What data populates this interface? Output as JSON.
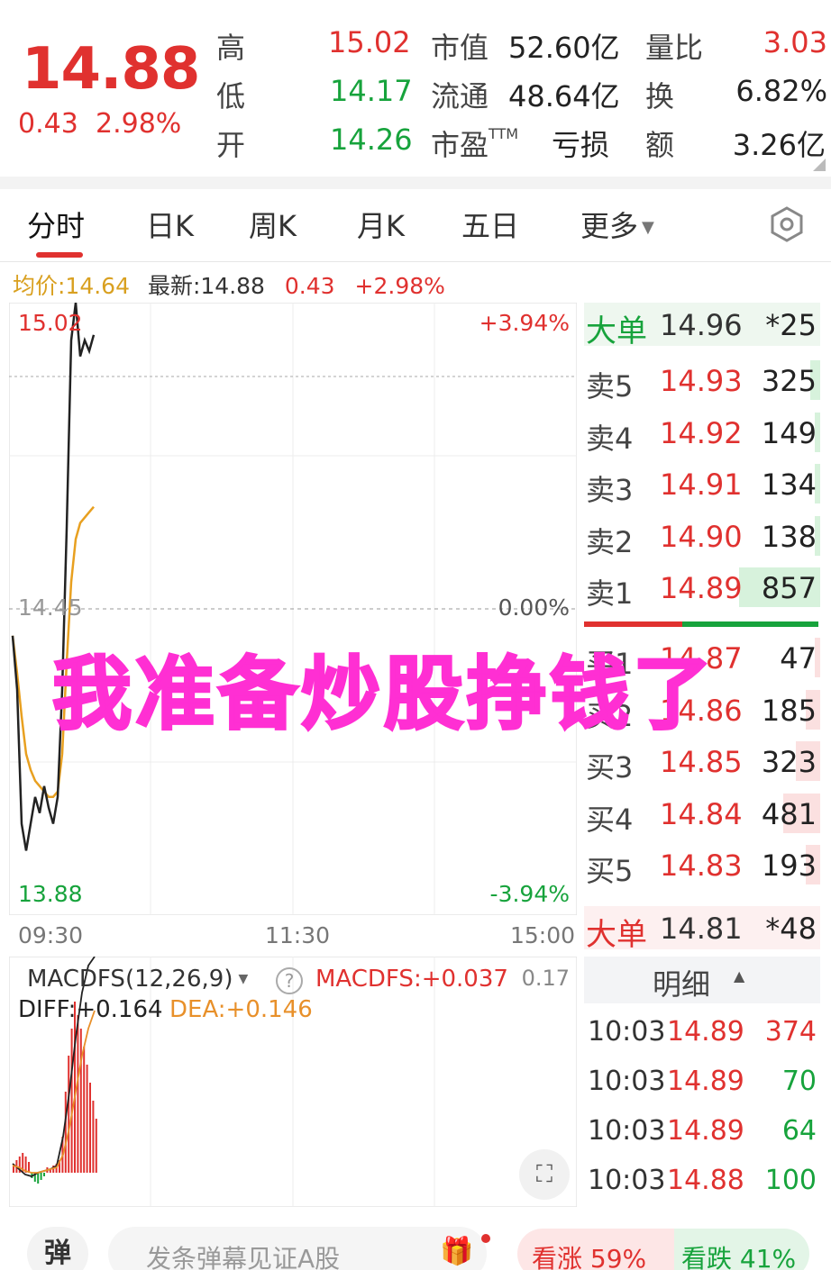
{
  "header": {
    "price": "14.88",
    "change": "0.43",
    "change_pct": "2.98%",
    "col1": [
      {
        "label": "高",
        "value": "15.02",
        "color": "#e0312f"
      },
      {
        "label": "低",
        "value": "14.17",
        "color": "#17a33c"
      },
      {
        "label": "开",
        "value": "14.26",
        "color": "#17a33c"
      }
    ],
    "col2": [
      {
        "label": "市值",
        "value": "52.60亿"
      },
      {
        "label": "流通",
        "value": "48.64亿"
      },
      {
        "label": "市盈",
        "label_sup": "TTM",
        "value": "亏损"
      }
    ],
    "col3": [
      {
        "label": "量比",
        "value": "3.03",
        "color": "#e0312f"
      },
      {
        "label": "换",
        "value": "6.82%",
        "color": "#222"
      },
      {
        "label": "额",
        "value": "3.26亿",
        "color": "#222"
      }
    ]
  },
  "tabs": [
    "分时",
    "日K",
    "周K",
    "月K",
    "五日",
    "更多"
  ],
  "active_tab": "分时",
  "info_line": {
    "avg_label": "均价:14.64",
    "latest_label": "最新:14.88",
    "change": "0.43",
    "change_pct": "+2.98%"
  },
  "chart": {
    "y_top": "15.02",
    "y_mid": "14.45",
    "y_bottom": "13.88",
    "pct_top": "+3.94%",
    "pct_mid": "0.00%",
    "pct_bottom": "-3.94%",
    "x_labels": [
      "09:30",
      "11:30",
      "15:00"
    ]
  },
  "chart_data": {
    "type": "line",
    "series": [
      {
        "name": "最新",
        "color": "#222222"
      },
      {
        "name": "均价",
        "color": "#e8a020"
      }
    ],
    "ylim": [
      13.88,
      15.02
    ],
    "pre_close": 14.45,
    "price": [
      14.4,
      14.3,
      14.05,
      14.0,
      14.05,
      14.1,
      14.07,
      14.12,
      14.08,
      14.05,
      14.1,
      14.3,
      14.6,
      14.95,
      15.02,
      14.92,
      14.95,
      14.93,
      14.96
    ],
    "avg_price": [
      14.4,
      14.33,
      14.25,
      14.18,
      14.15,
      14.13,
      14.12,
      14.11,
      14.1,
      14.1,
      14.11,
      14.18,
      14.35,
      14.5,
      14.58,
      14.61,
      14.62,
      14.63,
      14.64
    ]
  },
  "order_book": {
    "big_sell": {
      "label": "大单",
      "price": "14.96",
      "volume": "*25"
    },
    "asks": [
      {
        "label": "卖5",
        "price": "14.93",
        "volume": "325",
        "bar": 0.12
      },
      {
        "label": "卖4",
        "price": "14.92",
        "volume": "149",
        "bar": 0.06
      },
      {
        "label": "卖3",
        "price": "14.91",
        "volume": "134",
        "bar": 0.05
      },
      {
        "label": "卖2",
        "price": "14.90",
        "volume": "138",
        "bar": 0.05
      },
      {
        "label": "卖1",
        "price": "14.89",
        "volume": "857",
        "bar": 1.0
      }
    ],
    "bids": [
      {
        "label": "买1",
        "price": "14.87",
        "volume": "47",
        "bar": 0.04
      },
      {
        "label": "买2",
        "price": "14.86",
        "volume": "185",
        "bar": 0.18
      },
      {
        "label": "买3",
        "price": "14.85",
        "volume": "323",
        "bar": 0.3
      },
      {
        "label": "买4",
        "price": "14.84",
        "volume": "481",
        "bar": 0.45
      },
      {
        "label": "买5",
        "price": "14.83",
        "volume": "193",
        "bar": 0.18
      }
    ],
    "buy_sell_ratio": 0.42,
    "big_buy": {
      "label": "大单",
      "price": "14.81",
      "volume": "*48"
    }
  },
  "detail": {
    "title": "明细",
    "rows": [
      {
        "time": "10:03",
        "price": "14.89",
        "volume": "374",
        "vol_color": "#e0312f"
      },
      {
        "time": "10:03",
        "price": "14.89",
        "volume": "70",
        "vol_color": "#17a33c"
      },
      {
        "time": "10:03",
        "price": "14.89",
        "volume": "64",
        "vol_color": "#17a33c"
      },
      {
        "time": "10:03",
        "price": "14.88",
        "volume": "100",
        "vol_color": "#17a33c"
      }
    ]
  },
  "macd": {
    "name": "MACDFS(12,26,9)",
    "macd_value": "MACDFS:+0.037",
    "axis_top": "0.17",
    "diff": "DIFF:+0.164",
    "dea": "DEA:+0.146"
  },
  "banner_text": "我准备炒股挣钱了",
  "bottom": {
    "danmu_btn": "弹",
    "danmu_placeholder": "发条弹幕见证A股",
    "bullish": "看涨 59%",
    "bearish": "看跌 41%"
  },
  "colors": {
    "red": "#e0312f",
    "green": "#17a33c",
    "banner": "#ff2fd3",
    "avg_line": "#e8a020"
  }
}
